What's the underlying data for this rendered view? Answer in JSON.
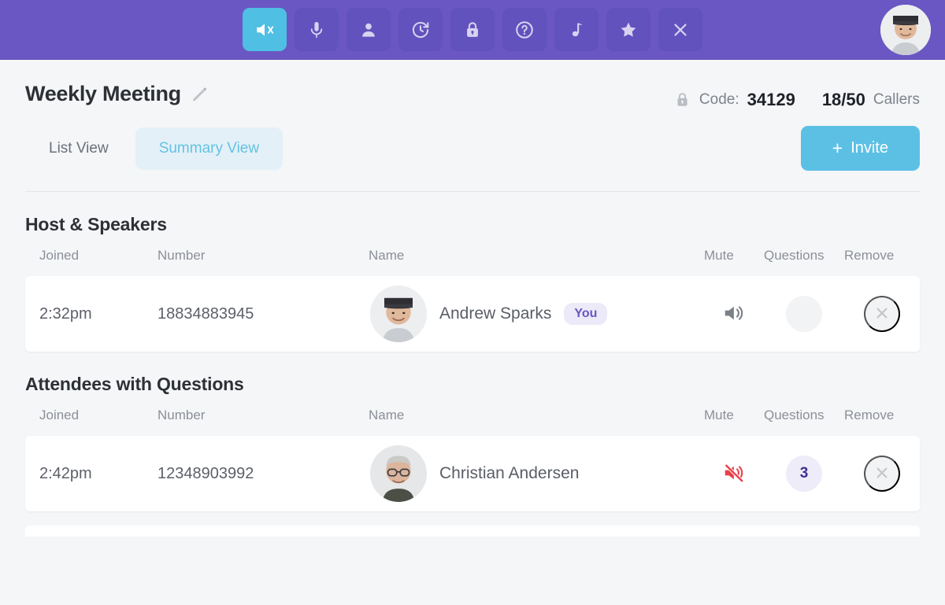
{
  "toolbar": {
    "buttons": [
      {
        "name": "speaker-mute-icon",
        "label": "Mute speaker",
        "active": true
      },
      {
        "name": "microphone-icon",
        "label": "Microphone",
        "active": false
      },
      {
        "name": "person-icon",
        "label": "Participants",
        "active": false
      },
      {
        "name": "history-clock-icon",
        "label": "History",
        "active": false
      },
      {
        "name": "lock-icon",
        "label": "Lock meeting",
        "active": false
      },
      {
        "name": "help-icon",
        "label": "Help",
        "active": false
      },
      {
        "name": "music-note-icon",
        "label": "Hold music",
        "active": false
      },
      {
        "name": "star-icon",
        "label": "Favorite",
        "active": false
      },
      {
        "name": "close-icon",
        "label": "End meeting",
        "active": false
      }
    ],
    "avatar_alt": "Andrew Sparks"
  },
  "header": {
    "title": "Weekly Meeting",
    "edit_icon": "pencil-icon",
    "lock_icon": "lock-icon",
    "code_label": "Code:",
    "code_value": "34129",
    "callers_value": "18/50",
    "callers_label": "Callers"
  },
  "tabs": [
    {
      "label": "List View",
      "active": false
    },
    {
      "label": "Summary View",
      "active": true
    }
  ],
  "invite": {
    "plus": "+",
    "label": "Invite"
  },
  "columns": {
    "joined": "Joined",
    "number": "Number",
    "name": "Name",
    "mute": "Mute",
    "questions": "Questions",
    "remove": "Remove"
  },
  "sections": [
    {
      "title": "Host & Speakers",
      "rows": [
        {
          "joined": "2:32pm",
          "number": "18834883945",
          "name": "Andrew Sparks",
          "badge": "You",
          "muted": false,
          "mute_icon": "speaker-on-icon",
          "questions": "",
          "has_questions": false,
          "remove_icon": "close-icon"
        }
      ]
    },
    {
      "title": "Attendees with Questions",
      "rows": [
        {
          "joined": "2:42pm",
          "number": "12348903992",
          "name": "Christian Andersen",
          "badge": "",
          "muted": true,
          "mute_icon": "speaker-muted-icon",
          "questions": "3",
          "has_questions": true,
          "remove_icon": "close-icon"
        }
      ]
    }
  ],
  "colors": {
    "header_purple": "#6a57c3",
    "accent_blue": "#5cc0e5",
    "tab_active_bg": "#e4f0f7",
    "badge_purple": "#6a57c3",
    "muted_red": "#e8414a",
    "question_text": "#3c3192"
  }
}
